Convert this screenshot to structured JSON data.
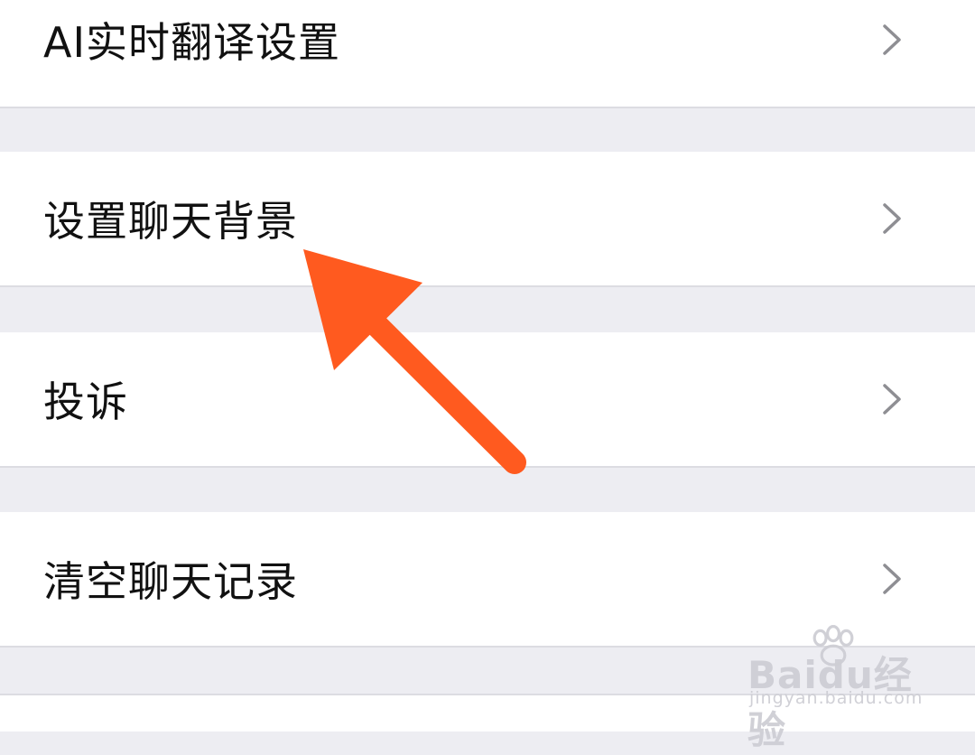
{
  "settings": {
    "items": [
      {
        "label": "AI实时翻译设置"
      },
      {
        "label": "设置聊天背景"
      },
      {
        "label": "投诉"
      },
      {
        "label": "清空聊天记录"
      }
    ]
  },
  "watermark": {
    "logo": "Baidu经验",
    "url": "jingyan.baidu.com"
  },
  "icons": {
    "chevron": "chevron-right-icon",
    "annotation": "arrow-icon",
    "paw": "paw-icon"
  },
  "colors": {
    "background": "#ededf2",
    "row": "#ffffff",
    "divider": "#dcdce2",
    "text": "#111111",
    "chevron": "#8e8e93",
    "annotation": "#ff5a1f"
  }
}
